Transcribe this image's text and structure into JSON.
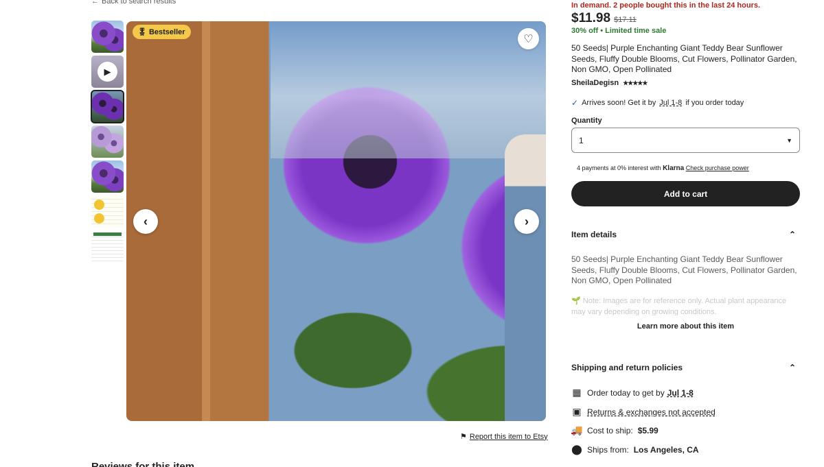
{
  "back_link": "Back to search results",
  "badge": "Bestseller",
  "report_link": "Report this item to Etsy",
  "reviews_title": "Reviews for this item",
  "demand": "In demand. 2 people bought this in the last 24 hours.",
  "price": "$11.98",
  "original_price": "$17.11",
  "discount": "30% off",
  "sale_note": "Limited time sale",
  "title": "50 Seeds| Purple Enchanting Giant Teddy Bear Sunflower Seeds, Fluffy Double Blooms, Cut Flowers, Pollinator Garden, Non GMO, Open Pollinated",
  "seller": "SheilaDegisn",
  "rating_stars": "★★★★★",
  "arrives": {
    "prefix": "Arrives soon! Get it by",
    "date": "Jul 1-8",
    "suffix": "if you order today"
  },
  "quantity": {
    "label": "Quantity",
    "selected": "1"
  },
  "klarna": {
    "text": "4 payments at 0% interest with",
    "brand": "Klarna",
    "link": "Check purchase power"
  },
  "add_to_cart": "Add to cart",
  "item_details": {
    "heading": "Item details",
    "text": "50 Seeds| Purple Enchanting Giant Teddy Bear Sunflower Seeds, Fluffy Double Blooms, Cut Flowers, Pollinator Garden, Non GMO, Open Pollinated",
    "note": "🌱 Note: Images are for reference only. Actual plant appearance may vary depending on growing conditions.",
    "learn_more": "Learn more about this item"
  },
  "shipping": {
    "heading": "Shipping and return policies",
    "order_prefix": "Order today to get by",
    "order_date": "Jul 1-8",
    "returns": "Returns & exchanges not accepted",
    "cost_label": "Cost to ship:",
    "cost_value": "$5.99",
    "from_label": "Ships from:",
    "from_value": "Los Angeles, CA"
  },
  "icons": {
    "back": "arrow-left-icon",
    "badge": "medal-icon",
    "favorite": "heart-icon",
    "prev": "chevron-left-icon",
    "next": "chevron-right-icon",
    "flag": "flag-icon",
    "check": "check-icon",
    "calendar": "calendar-icon",
    "returns": "package-icon",
    "truck": "truck-icon",
    "location": "location-pin-icon"
  },
  "colors": {
    "demand": "#b2261d",
    "sale": "#2f7a32",
    "badge": "#f4c84a",
    "cart_button": "#222222"
  }
}
